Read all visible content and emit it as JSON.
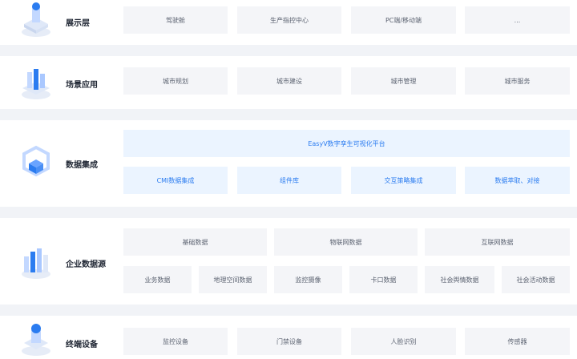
{
  "layers": [
    {
      "title": "展示层",
      "items": [
        "驾驶舱",
        "生产指控中心",
        "PC端/移动端",
        "..."
      ],
      "icon": "cube-stack-icon"
    },
    {
      "title": "场景应用",
      "items": [
        "城市规划",
        "城市建设",
        "城市管理",
        "城市服务"
      ],
      "icon": "city-buildings-icon"
    },
    {
      "title": "数据集成",
      "platform": "EasyV数字孪生可视化平台",
      "items": [
        "CMI数据集成",
        "组件库",
        "交互策略集成",
        "数据萃取、对接"
      ],
      "icon": "hexagon-cube-icon"
    },
    {
      "title": "企业数据源",
      "row1": [
        "基础数据",
        "物联网数据",
        "互联网数据"
      ],
      "row2": [
        "业务数据",
        "地理空间数据",
        "监控摄像",
        "卡口数据",
        "社会舆情数据",
        "社会活动数据"
      ],
      "icon": "data-bars-icon"
    },
    {
      "title": "终端设备",
      "items": [
        "监控设备",
        "门禁设备",
        "人脸识别",
        "传感器"
      ],
      "icon": "terminal-device-icon"
    }
  ],
  "colors": {
    "accent": "#2b7cf0",
    "box": "#f4f5f8",
    "box_blue": "#ebf4ff",
    "background": "#f1f3f7"
  }
}
